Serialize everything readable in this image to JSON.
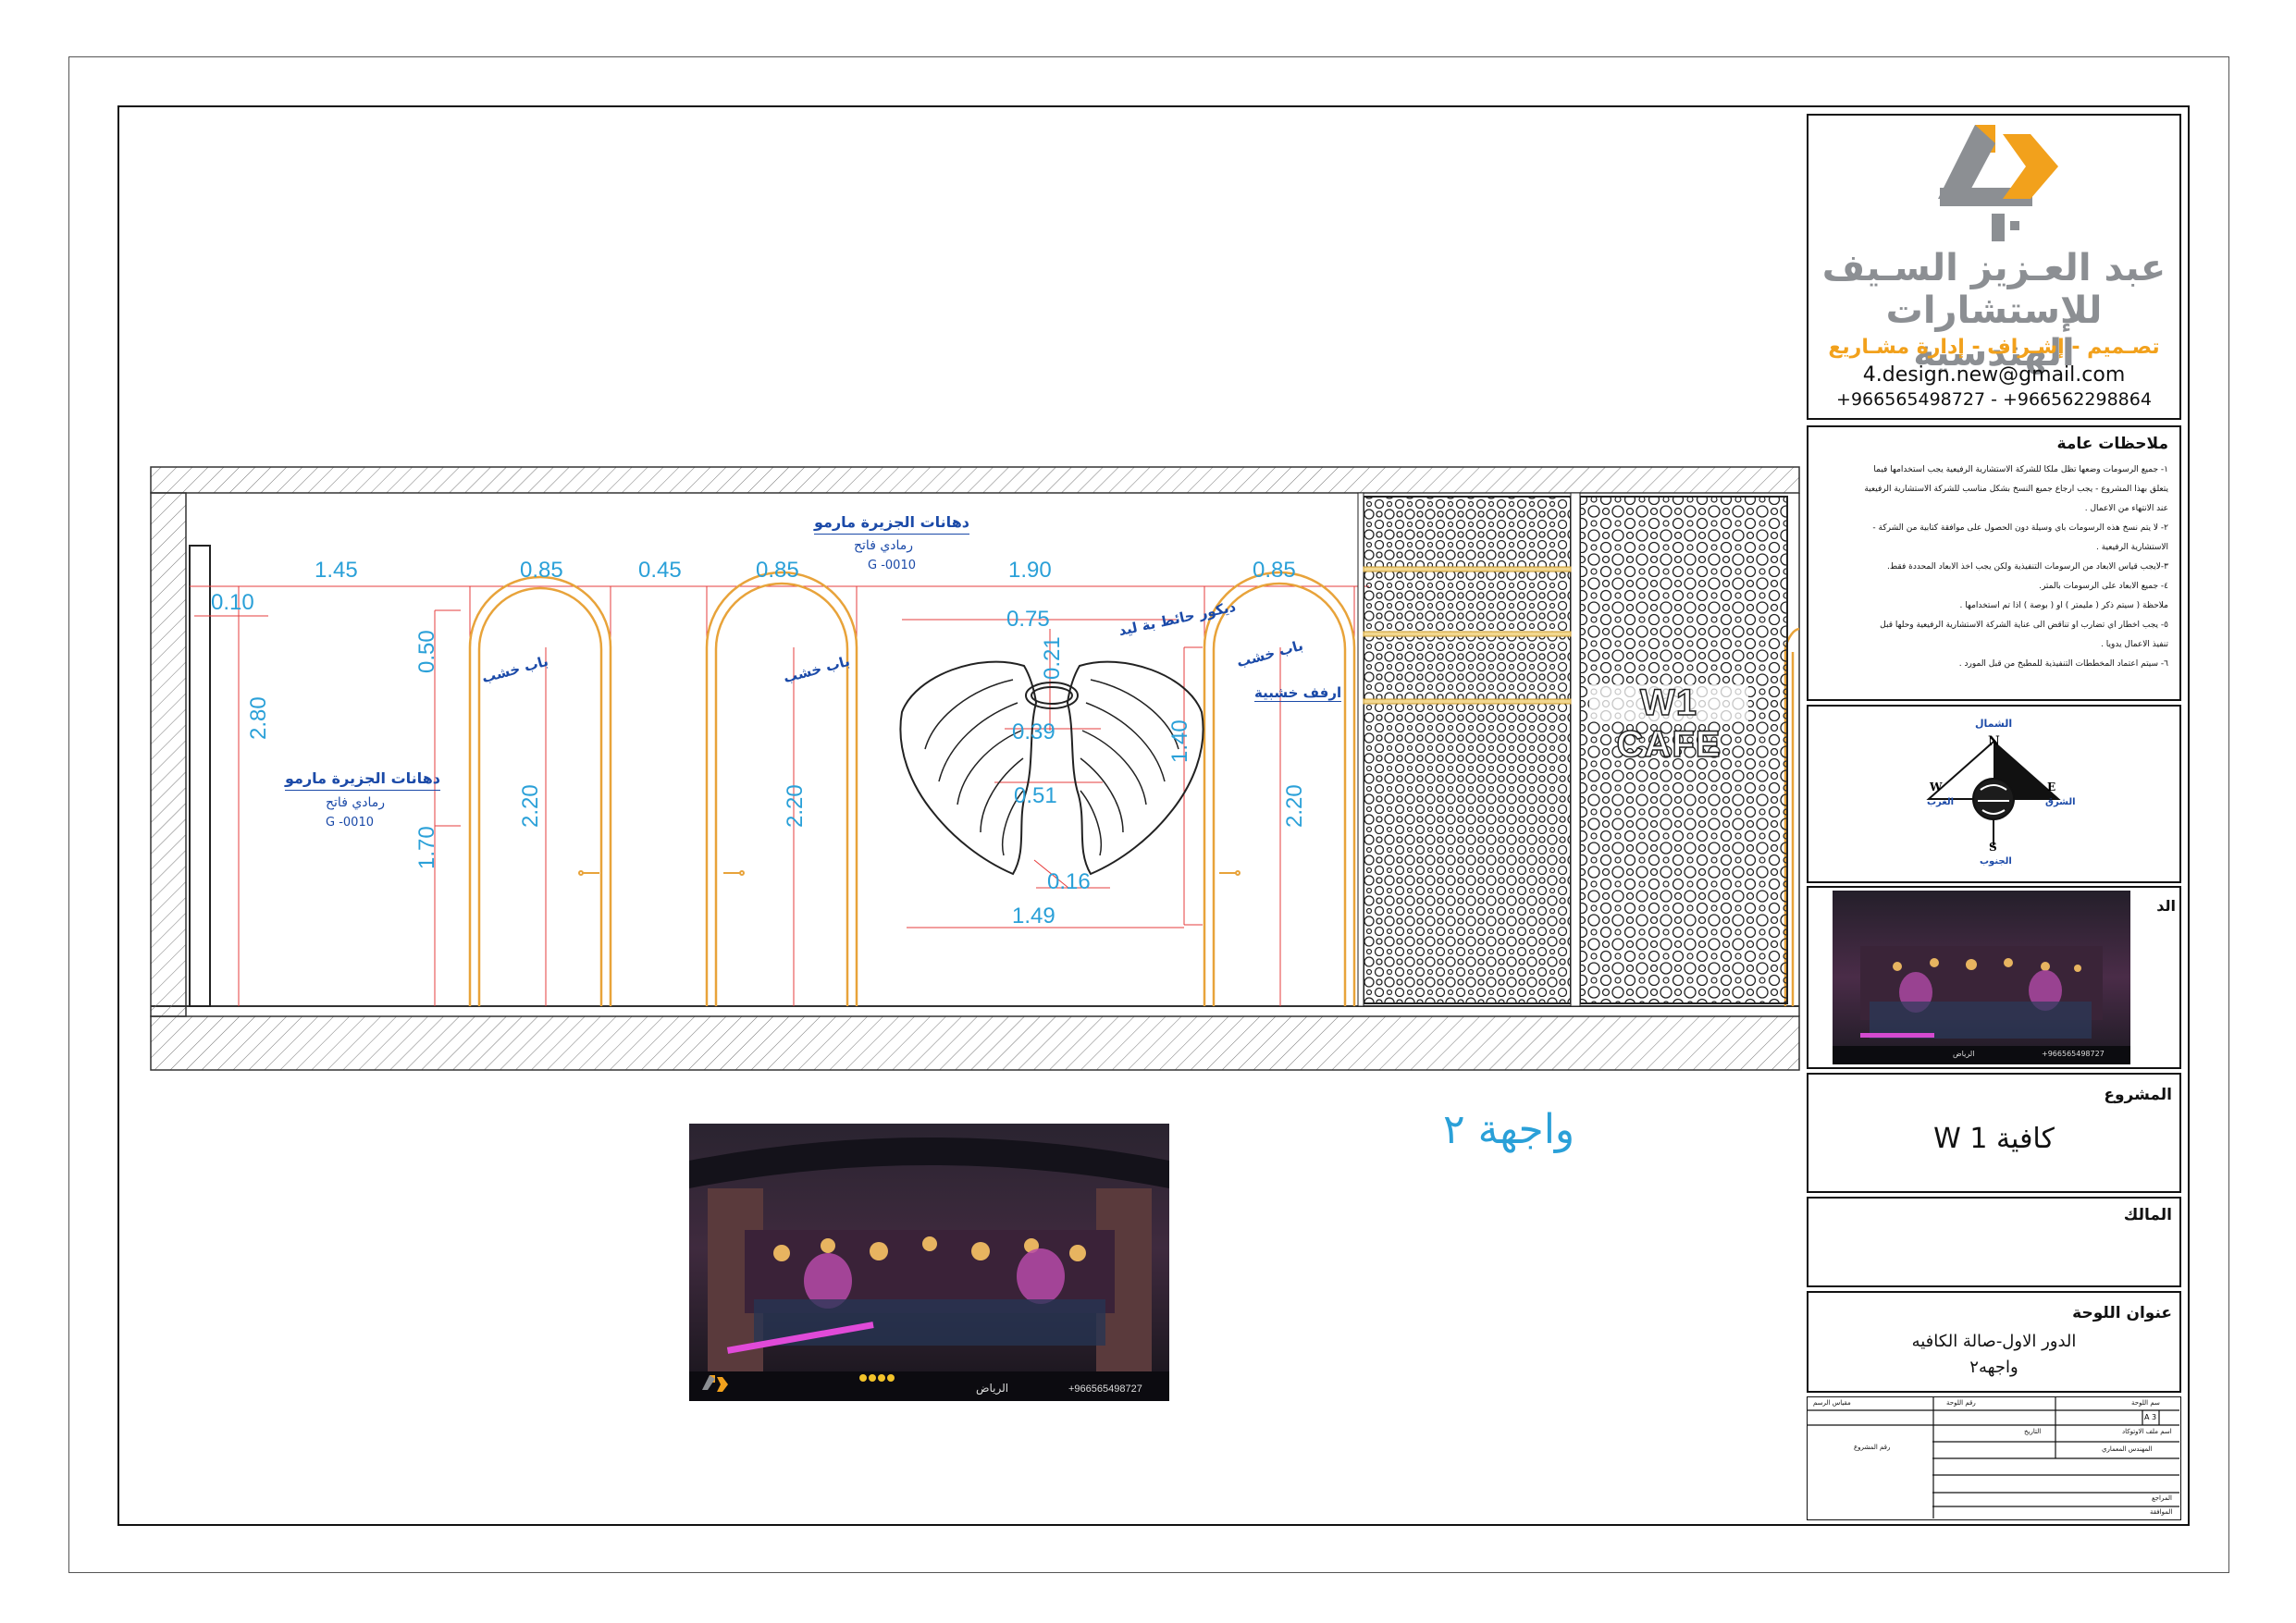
{
  "company": {
    "name_line1": "عبد العـزيز السـيف",
    "name_line2": "للإستشارات الهندسية",
    "services": "تصـميم - إشـراف - إدارة مشـاريع",
    "email": "4.design.new@gmail.com",
    "phones": "+966565498727 - +966562298864"
  },
  "notes": {
    "title": "ملاحظات عامة",
    "lines": [
      "١- جميع الرسومات وضعها تظل ملكا للشركة الاستشارية الرفيعية يجب استخدامها فيما",
      "يتعلق بهذا المشروع - يجب ارجاع جميع النسخ بشكل مناسب للشركة الاستشارية الرفيعية",
      "عند الانتهاء من الاعمال .",
      "٢- لا يتم نسخ هذه الرسومات باي وسيلة دون الحصول على موافقة كتابية من الشركة -",
      "الاستشارية الرفيعية .",
      "٣-لايجب قياس الابعاد من الرسومات التنفيذية ولكن يجب اخذ الابعاد المحددة فقط.",
      "٤- جميع الابعاد على الرسومات بالمتر.",
      "ملاحظة ( سيتم ذكر ( مليمتر ) او ( بوصة ) اذا تم استخدامها .",
      "٥- يجب اخطار اي تضارب او تناقض الى عناية الشركة الاستشارية الرفيعية وحلها قبل",
      "تنفيذ الاعمال يدويا .",
      "٦- سيتم اعتماد المخططات التنفيذية للمطبخ من قبل المورد ."
    ]
  },
  "compass": {
    "north_ar": "الشمال",
    "north": "N",
    "south_ar": "الجنوب",
    "south": "S",
    "east_ar": "الشرق",
    "east": "E",
    "west_ar": "الغرب",
    "west": "W"
  },
  "key_plan": {
    "label": "الد"
  },
  "project": {
    "label": "المشروع",
    "value": "كافية W 1"
  },
  "owner": {
    "label": "المالك"
  },
  "sheet": {
    "label": "عنوان اللوحة",
    "line1": "الدور الاول-صالة الكافيه",
    "line2": "واجهه٢"
  },
  "title_table": {
    "row1": [
      "مقياس الرسم",
      "رقم اللوحة",
      "سم اللوحة"
    ],
    "row2": [
      "التاريخ",
      "اسم ملف الاوتوكاد"
    ],
    "row2_val": "A 3",
    "row3": [
      "رقم المشروع",
      "المهندس المعماري"
    ],
    "row4": "المراجع",
    "row5": "الموافقة"
  },
  "drawing": {
    "elevation_title": "واجهة ٢",
    "paint_label_1": "دهانات الجزيرة مارمو",
    "paint_sub_1": "رمادي فاتح",
    "paint_code_1": "G -0010",
    "paint_label_2": "دهانات الجزيرة مارمو",
    "paint_sub_2": "رمادي فاتح",
    "paint_code_2": "G -0010",
    "door_label_1": "باب خشب",
    "door_label_2": "باب خشب",
    "door_label_3": "باب خشب",
    "decor_label": "ديكور حائط بة ليد",
    "shelves_label": "ارفف خشبية",
    "cafe_sign": "W1 CAFE",
    "dims_top": [
      "1.45",
      "0.85",
      "0.45",
      "0.85",
      "1.90",
      "0.85"
    ],
    "dim_010": "0.10",
    "dim_280": "2.80",
    "dim_050": "0.50",
    "dim_170": "1.70",
    "dim_door_h1": "2.20",
    "dim_door_h2": "2.20",
    "dim_door_h3": "2.20",
    "dim_075": "0.75",
    "dim_021": "0.21",
    "dim_039": "0.39",
    "dim_051": "0.51",
    "dim_016": "0.16",
    "dim_149": "1.49",
    "dim_140": "1.40"
  },
  "render_bottom": {
    "location": "الرياض",
    "phone": "+966565498727"
  },
  "render_small": {
    "location": "الرياض",
    "phone": "+966565498727"
  },
  "colors": {
    "dimension": "#2aa0d8",
    "label": "#1b4aa8",
    "door": "#e8a33a",
    "guide": "#e63c3c",
    "services": "#f2a11c",
    "logo_grey": "#8c8f93"
  }
}
